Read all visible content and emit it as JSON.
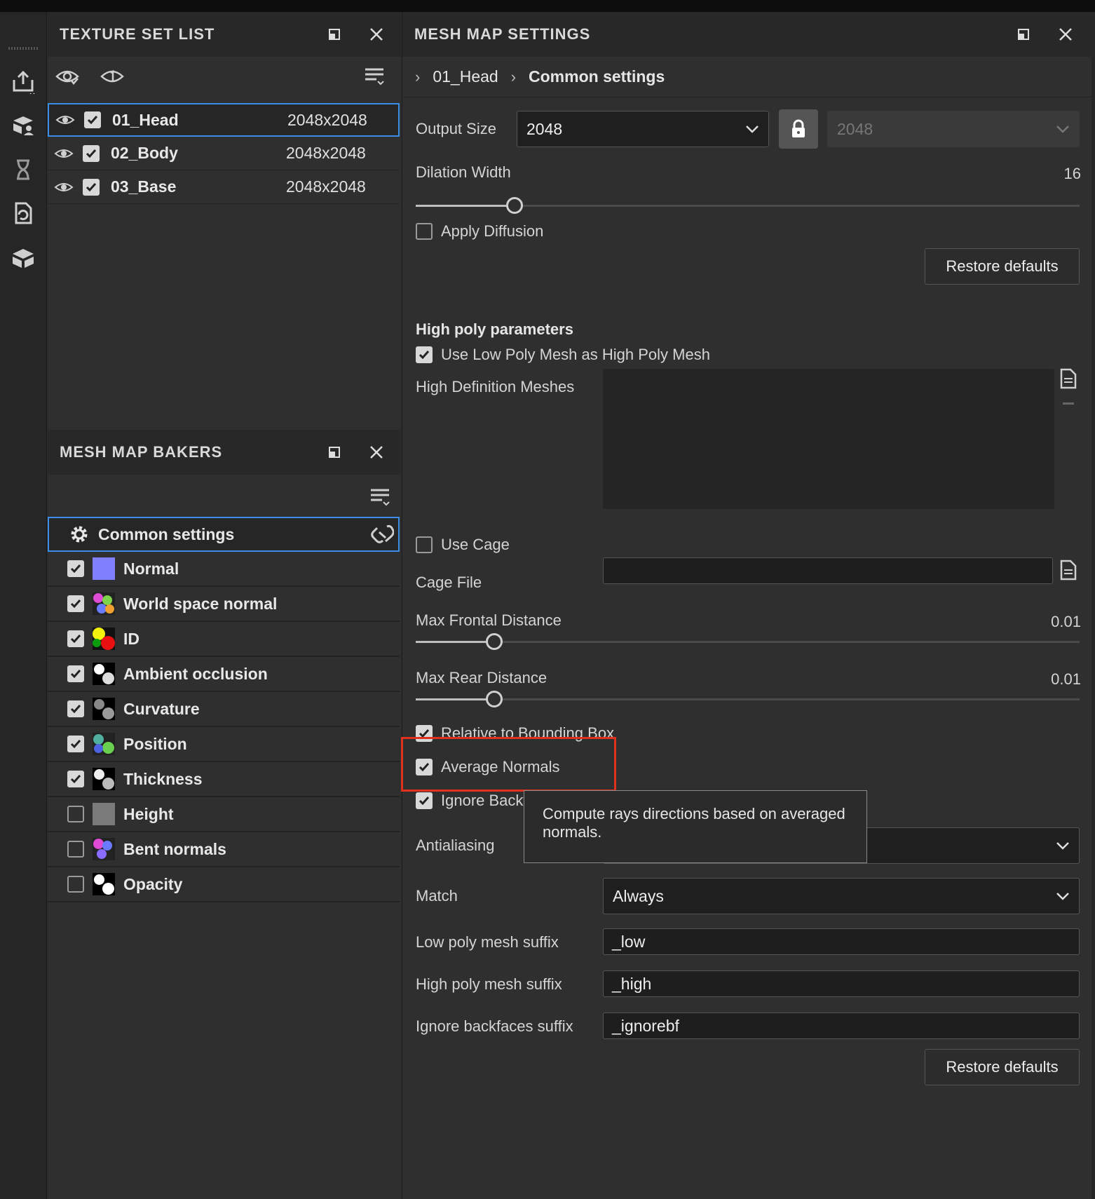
{
  "toolbar": {
    "tools": [
      {
        "icon": "export-icon"
      },
      {
        "icon": "texture-set-icon"
      },
      {
        "icon": "history-icon"
      },
      {
        "icon": "refresh-document-icon"
      },
      {
        "icon": "mesh-cube-icon"
      }
    ]
  },
  "texture_set_list": {
    "title": "TEXTURE SET LIST",
    "rows": [
      {
        "name": "01_Head",
        "resolution": "2048x2048",
        "checked": true,
        "selected": true
      },
      {
        "name": "02_Body",
        "resolution": "2048x2048",
        "checked": true,
        "selected": false
      },
      {
        "name": "03_Base",
        "resolution": "2048x2048",
        "checked": true,
        "selected": false
      }
    ]
  },
  "mesh_map_bakers": {
    "title": "MESH MAP BAKERS",
    "common_label": "Common settings",
    "bakers": [
      {
        "name": "Normal",
        "checked": true
      },
      {
        "name": "World space normal",
        "checked": true
      },
      {
        "name": "ID",
        "checked": true
      },
      {
        "name": "Ambient occlusion",
        "checked": true
      },
      {
        "name": "Curvature",
        "checked": true
      },
      {
        "name": "Position",
        "checked": true
      },
      {
        "name": "Thickness",
        "checked": true
      },
      {
        "name": "Height",
        "checked": false
      },
      {
        "name": "Bent normals",
        "checked": false
      },
      {
        "name": "Opacity",
        "checked": false
      }
    ]
  },
  "mesh_map_settings": {
    "title": "MESH MAP SETTINGS",
    "breadcrumb": {
      "item1": "01_Head",
      "item2": "Common settings"
    },
    "output_size_label": "Output Size",
    "output_size_value": "2048",
    "output_size_locked_value": "2048",
    "dilation_label": "Dilation Width",
    "dilation_value": "16",
    "dilation_fraction": 0.14,
    "apply_diffusion_label": "Apply Diffusion",
    "restore_defaults": "Restore defaults",
    "high_poly_section": "High poly parameters",
    "use_low_as_high_label": "Use Low Poly Mesh as High Poly Mesh",
    "high_def_meshes_label": "High Definition Meshes",
    "use_cage_label": "Use Cage",
    "cage_file_label": "Cage File",
    "max_frontal_label": "Max Frontal Distance",
    "max_frontal_value": "0.01",
    "max_frontal_fraction": 0.11,
    "max_rear_label": "Max Rear Distance",
    "max_rear_value": "0.01",
    "max_rear_fraction": 0.11,
    "relative_bbox_label": "Relative to Bounding Box",
    "average_normals_label": "Average Normals",
    "ignore_backface_label": "Ignore Backface",
    "antialiasing_label": "Antialiasing",
    "match_label": "Match",
    "match_value": "Always",
    "low_suffix_label": "Low poly mesh suffix",
    "low_suffix_value": "_low",
    "high_suffix_label": "High poly mesh suffix",
    "high_suffix_value": "_high",
    "ignore_bf_suffix_label": "Ignore backfaces suffix",
    "ignore_bf_suffix_value": "_ignorebf",
    "tooltip": "Compute rays directions based on averaged normals."
  },
  "colors": {
    "accent": "#3a8ee6",
    "highlight": "#e0301e"
  }
}
